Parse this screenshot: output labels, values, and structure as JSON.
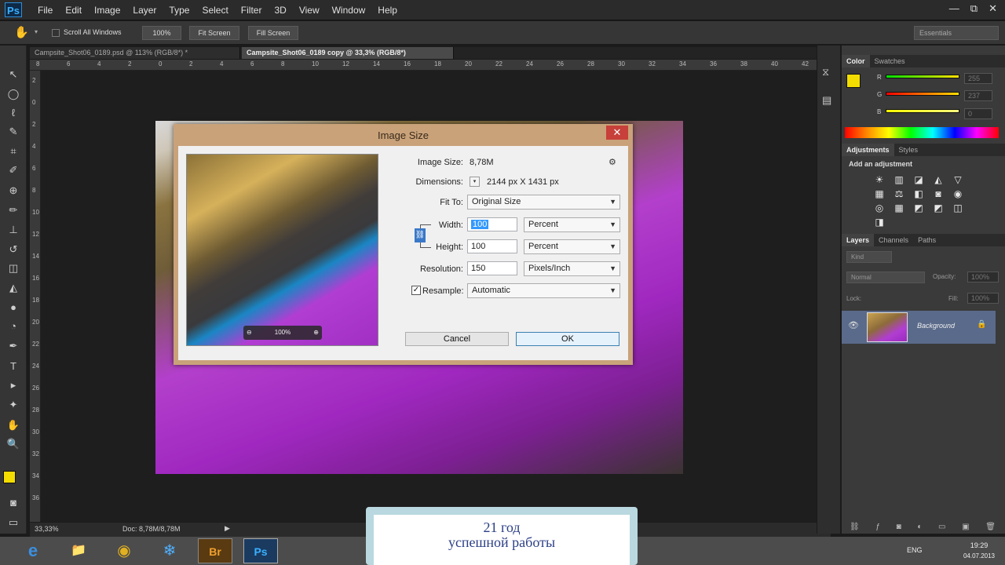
{
  "menubar": {
    "logo": "Ps",
    "items": [
      "File",
      "Edit",
      "Image",
      "Layer",
      "Type",
      "Select",
      "Filter",
      "3D",
      "View",
      "Window",
      "Help"
    ],
    "window_buttons": [
      "—",
      "⧉",
      "✕"
    ]
  },
  "options": {
    "scroll_all": "Scroll All Windows",
    "btn_100": "100%",
    "fit_screen": "Fit Screen",
    "fill_screen": "Fill Screen",
    "workspace": "Essentials"
  },
  "tabs": [
    {
      "label": "Campsite_Shot06_0189.psd @ 113% (RGB/8*) *",
      "active": false
    },
    {
      "label": "Campsite_Shot06_0189 copy @ 33,3% (RGB/8*)",
      "active": true
    }
  ],
  "ruler_h": [
    "8",
    "6",
    "4",
    "2",
    "0",
    "2",
    "4",
    "6",
    "8",
    "10",
    "12",
    "14",
    "16",
    "18",
    "20",
    "22",
    "24",
    "26",
    "28",
    "30",
    "32",
    "34",
    "36",
    "38",
    "40",
    "42"
  ],
  "ruler_v": [
    "2",
    "0",
    "2",
    "4",
    "6",
    "8",
    "10",
    "12",
    "14",
    "16",
    "18",
    "20",
    "22",
    "24",
    "26",
    "28",
    "30",
    "32",
    "34",
    "36"
  ],
  "status": {
    "zoom": "33,33%",
    "doc": "Doc: 8,78M/8,78M"
  },
  "dialog": {
    "title": "Image Size",
    "close": "✕",
    "image_size_label": "Image Size:",
    "image_size_value": "8,78M",
    "dimensions_label": "Dimensions:",
    "dimensions_value": "2144 px  X  1431 px",
    "fit_to_label": "Fit To:",
    "fit_to_value": "Original Size",
    "width_label": "Width:",
    "width_value": "100",
    "width_unit": "Percent",
    "height_label": "Height:",
    "height_value": "100",
    "height_unit": "Percent",
    "resolution_label": "Resolution:",
    "resolution_value": "150",
    "resolution_unit": "Pixels/Inch",
    "resample_label": "Resample:",
    "resample_value": "Automatic",
    "resample_checked": true,
    "zoom": "100%",
    "cancel": "Cancel",
    "ok": "OK"
  },
  "panels": {
    "color_tabs": [
      "Color",
      "Swatches"
    ],
    "color_rows": [
      {
        "ch": "R",
        "value": "255",
        "color": "#e6c200"
      },
      {
        "ch": "G",
        "value": "237",
        "color": "#e6e000"
      },
      {
        "ch": "B",
        "value": "0",
        "color": "#e8e800"
      }
    ],
    "fg_color": "#f3dd00",
    "adjust_tabs": [
      "Adjustments",
      "Styles"
    ],
    "add_adjustment": "Add an adjustment",
    "adj_icons": [
      "☀",
      "▥",
      "◪",
      "◭",
      "▽",
      "▦",
      "⚖",
      "◧",
      "◙",
      "◉",
      "◎",
      "▦",
      "◩",
      "◩",
      "◫",
      "◨"
    ],
    "layers_tabs": [
      "Layers",
      "Channels",
      "Paths"
    ],
    "kind": "Kind",
    "blend": "Normal",
    "opacity_label": "Opacity:",
    "opacity": "100%",
    "lock_label": "Lock:",
    "fill_label": "Fill:",
    "fill": "100%",
    "layer_name": "Background"
  },
  "taskbar": {
    "icons": [
      "e",
      "📁",
      "◉",
      "❄",
      "Br",
      "Ps"
    ],
    "lang": "ENG",
    "time": "19:29",
    "date": "04.07.2013"
  },
  "overlay": {
    "line1": "21 год",
    "line2": "успешной работы"
  }
}
